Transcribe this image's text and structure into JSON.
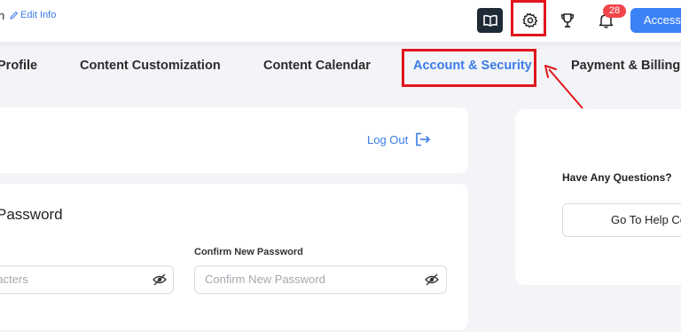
{
  "header": {
    "user_name": "n",
    "edit_info": "Edit Info",
    "notification_count": "28",
    "access_label": "Access",
    "icons": [
      "book-icon",
      "gear-icon",
      "trophy-icon",
      "bell-icon"
    ]
  },
  "tabs": [
    {
      "label": "Profile"
    },
    {
      "label": "Content Customization"
    },
    {
      "label": "Content Calendar"
    },
    {
      "label": "Account & Security",
      "active": true
    },
    {
      "label": "Payment & Billing"
    }
  ],
  "logout": {
    "label": "Log Out"
  },
  "password": {
    "title": "Password",
    "left_placeholder": "racters",
    "confirm_label": "Confirm New Password",
    "confirm_placeholder": "Confirm New Password"
  },
  "help": {
    "question": "Have Any Questions?",
    "button_label": "Go To Help Ce"
  },
  "colors": {
    "accent": "#3b7be8",
    "highlight": "#e0161c",
    "badge": "#f0454b",
    "dark": "#1f2a37"
  }
}
